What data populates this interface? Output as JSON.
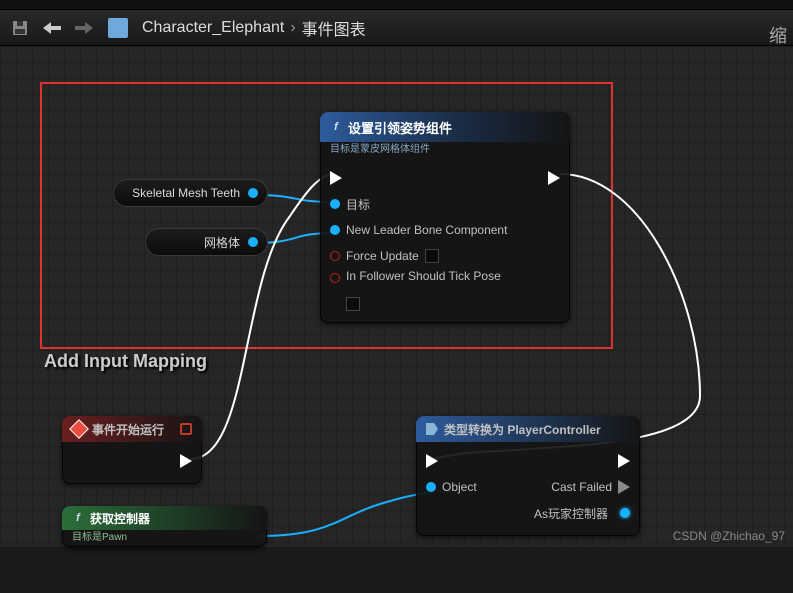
{
  "toolbar": {
    "breadcrumb": [
      "Character_Elephant",
      "事件图表"
    ],
    "zoom_label": "缩"
  },
  "highlight_label": "Add Input Mapping",
  "node_setleader": {
    "title": "设置引领姿势组件",
    "subtitle": "目标是蒙皮网格体组件",
    "pins": {
      "target": "目标",
      "new_leader": "New Leader Bone Component",
      "force": "Force Update",
      "tick": "In Follower Should Tick Pose"
    }
  },
  "pill_teeth": {
    "label": "Skeletal Mesh Teeth"
  },
  "pill_mesh": {
    "label": "网格体"
  },
  "node_beginplay": {
    "title": "事件开始运行"
  },
  "node_cast": {
    "title": "类型转换为 PlayerController",
    "object": "Object",
    "fail": "Cast Failed",
    "as": "As玩家控制器"
  },
  "node_getctrl": {
    "title": "获取控制器",
    "subtitle": "目标是Pawn"
  },
  "watermark": "CSDN @Zhichao_97"
}
